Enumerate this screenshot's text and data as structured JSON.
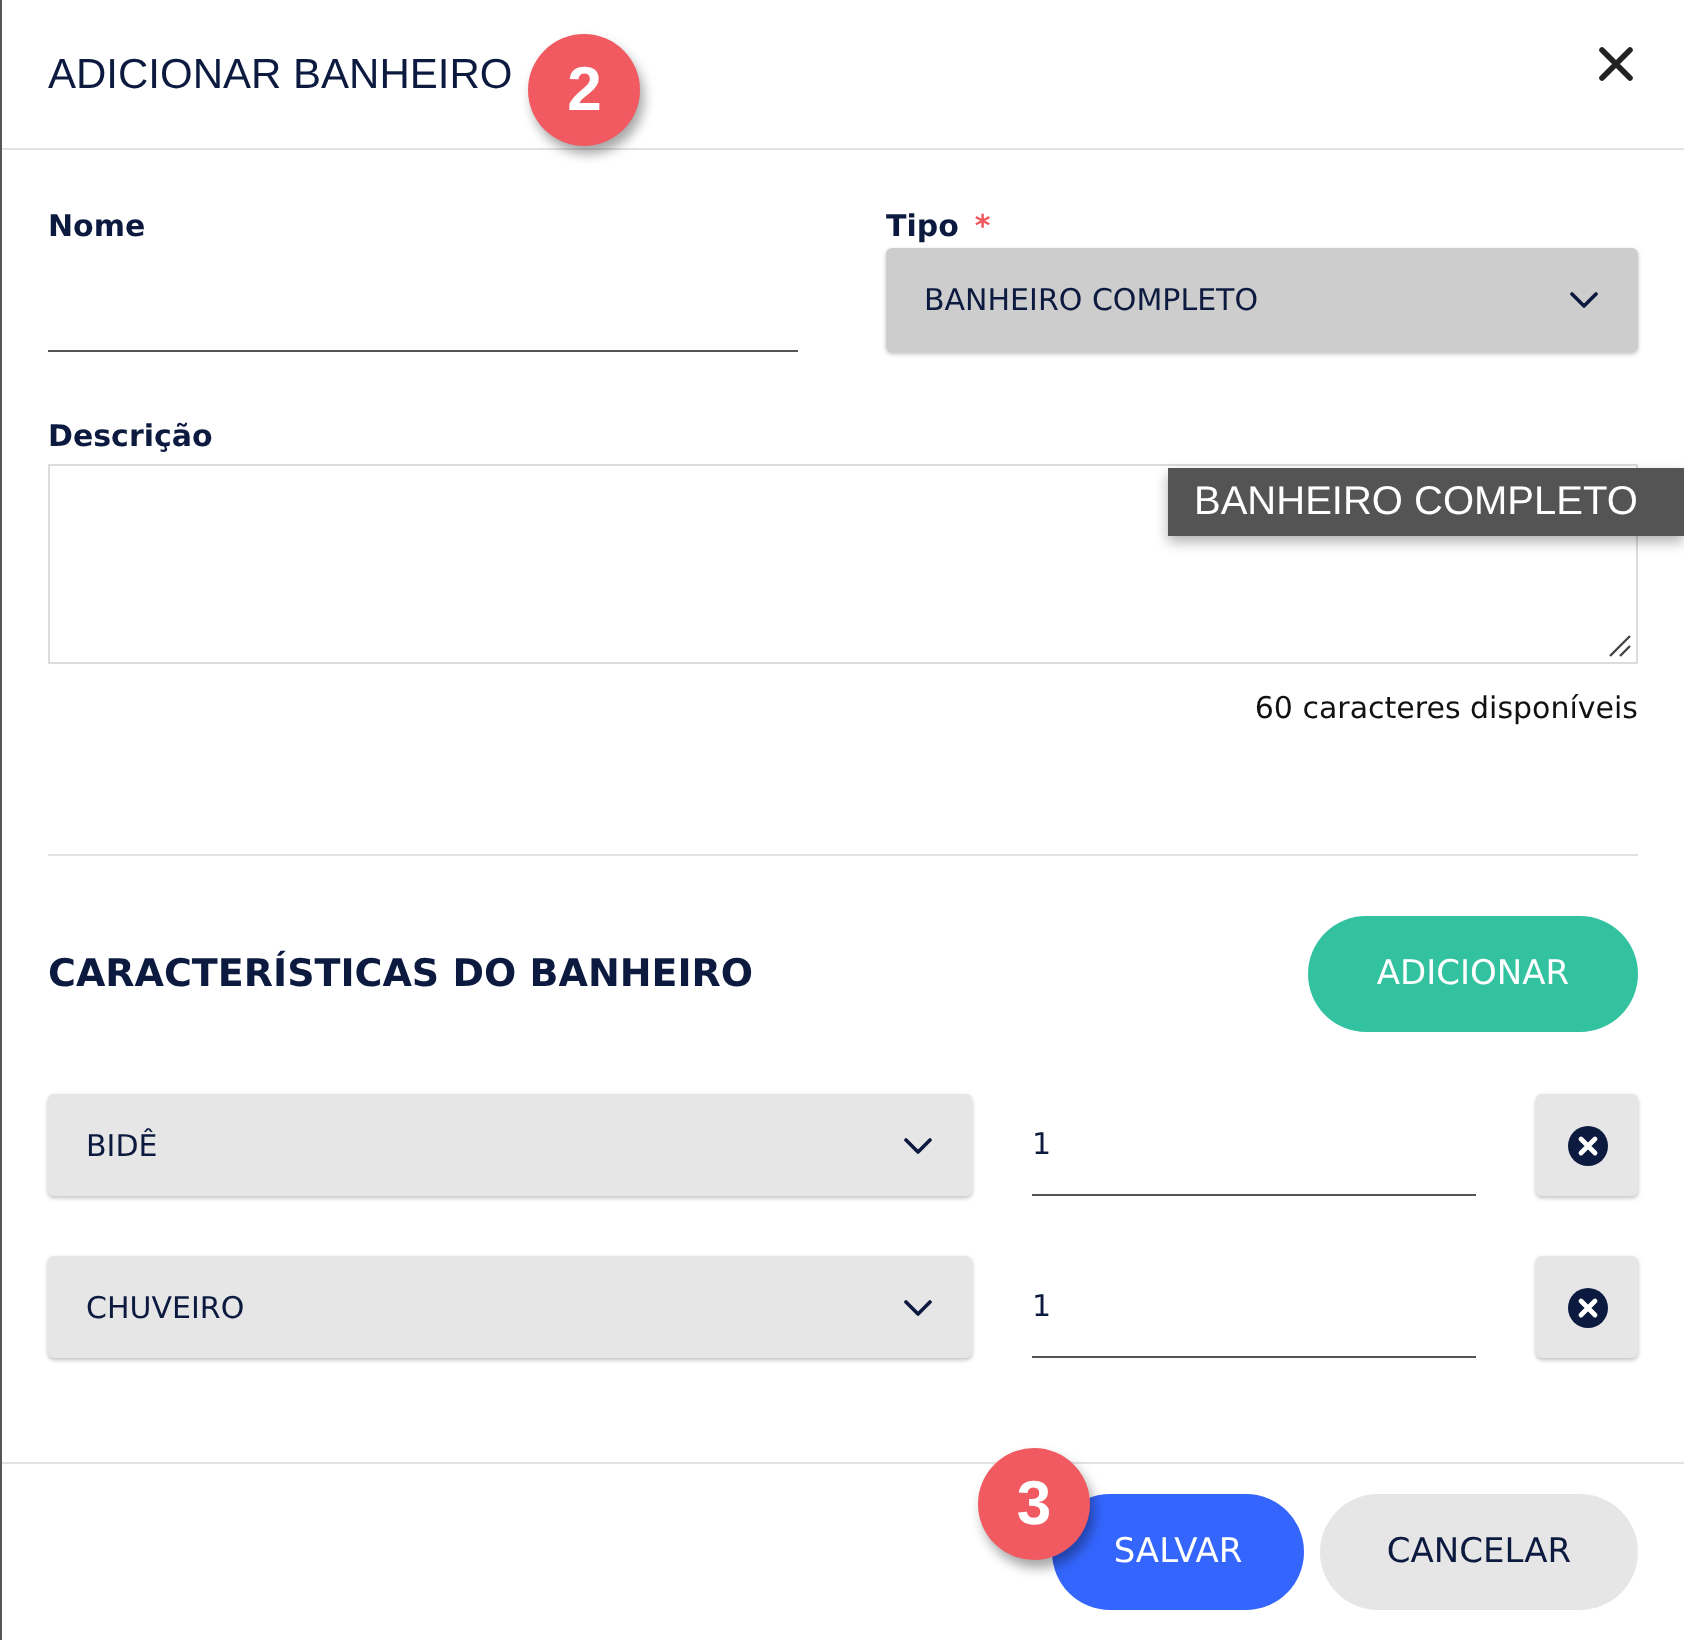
{
  "dialog": {
    "title": "ADICIONAR BANHEIRO",
    "badge": "2"
  },
  "fields": {
    "name": {
      "label": "Nome"
    },
    "type": {
      "label": "Tipo",
      "required_mark": "*",
      "value": "BANHEIRO COMPLETO",
      "hovered": true
    },
    "tooltip": "BANHEIRO COMPLETO",
    "description": {
      "label": "Descrição",
      "counter": "60 caracteres disponíveis"
    }
  },
  "features": {
    "title": "CARACTERÍSTICAS DO BANHEIRO",
    "add_button": "ADICIONAR",
    "items": [
      {
        "type": "BIDÊ",
        "quantity": "1"
      },
      {
        "type": "CHUVEIRO",
        "quantity": "1"
      }
    ]
  },
  "footer": {
    "badge": "3",
    "buttons": [
      {
        "label": "SALVAR",
        "kind": "primary"
      },
      {
        "label": "CANCELAR",
        "kind": "secondary"
      }
    ]
  }
}
